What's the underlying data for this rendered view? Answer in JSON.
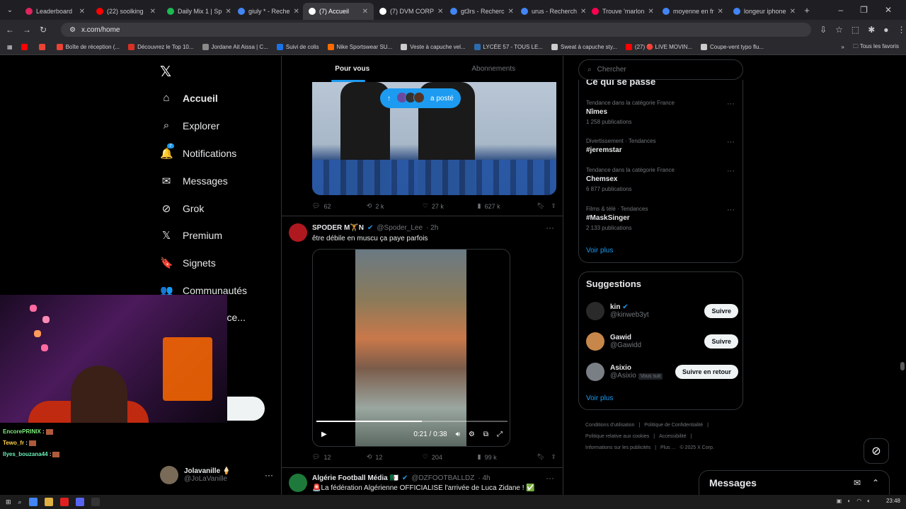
{
  "browser": {
    "tabs": [
      {
        "label": "Leaderboard",
        "color": "#e0245e",
        "active": false
      },
      {
        "label": "(22) soolking",
        "color": "#ff0000",
        "active": false
      },
      {
        "label": "Daily Mix 1 | Sp",
        "color": "#1db954",
        "active": false
      },
      {
        "label": "giuly * - Reche",
        "color": "#4285f4",
        "active": false
      },
      {
        "label": "(7) Accueil",
        "color": "#ffffff",
        "active": true
      },
      {
        "label": "(7) DVM CORP",
        "color": "#ffffff",
        "active": false
      },
      {
        "label": "gt3rs - Recherc",
        "color": "#4285f4",
        "active": false
      },
      {
        "label": "urus - Recherch",
        "color": "#4285f4",
        "active": false
      },
      {
        "label": "Trouve 'marlon",
        "color": "#ff0050",
        "active": false
      },
      {
        "label": "moyenne en fr",
        "color": "#4285f4",
        "active": false
      },
      {
        "label": "longeur iphone",
        "color": "#4285f4",
        "active": false
      }
    ],
    "new_tab": "+",
    "url": "x.com/home",
    "bookmarks": [
      {
        "label": "",
        "color": "#ff0000"
      },
      {
        "label": "",
        "color": "#ea4335"
      },
      {
        "label": "Boîte de réception (...",
        "color": "#ea4335"
      },
      {
        "label": "Découvrez le Top 10...",
        "color": "#d93025"
      },
      {
        "label": "Jordane Ait Aissa | C...",
        "color": "#8a8a8a"
      },
      {
        "label": "Suivi de colis",
        "color": "#1a73e8"
      },
      {
        "label": "Nike Sportswear SU...",
        "color": "#ff6a00"
      },
      {
        "label": "Veste à capuche vel...",
        "color": "#cccccc"
      },
      {
        "label": "LYCÉE 57 - TOUS LE...",
        "color": "#2b6cb0"
      },
      {
        "label": "Sweat à capuche sty...",
        "color": "#cccccc"
      },
      {
        "label": "(27) 🔴 LIVE MOVIN...",
        "color": "#ff0000"
      },
      {
        "label": "Coupe-vent typo flu...",
        "color": "#cccccc"
      }
    ],
    "all_bookmarks": "Tous les favoris"
  },
  "nav": {
    "items": [
      {
        "label": "Accueil",
        "icon": "home-icon",
        "glyph": "⌂",
        "bold": true
      },
      {
        "label": "Explorer",
        "icon": "search-icon",
        "glyph": "⌕",
        "bold": false
      },
      {
        "label": "Notifications",
        "icon": "bell-icon",
        "glyph": "🔔",
        "bold": false,
        "badge": "7"
      },
      {
        "label": "Messages",
        "icon": "mail-icon",
        "glyph": "✉",
        "bold": false
      },
      {
        "label": "Grok",
        "icon": "grok-icon",
        "glyph": "⊘",
        "bold": false
      },
      {
        "label": "Premium",
        "icon": "x-premium-icon",
        "glyph": "𝕏",
        "bold": false
      },
      {
        "label": "Signets",
        "icon": "bookmark-icon",
        "glyph": "🔖",
        "bold": false
      },
      {
        "label": "Communautés",
        "icon": "communities-icon",
        "glyph": "👥",
        "bold": false
      },
      {
        "label": "ons ce...",
        "icon": "",
        "glyph": "",
        "bold": false
      }
    ],
    "profile": {
      "name": "Jolavanille 🍦",
      "handle": "@JoLaVanille"
    }
  },
  "stream_chat": [
    {
      "user": "EncorePRINIX",
      "sep": " :"
    },
    {
      "user": "Tewo_fr",
      "sep": " :"
    },
    {
      "user": "Ilyes_bouzana44",
      "sep": " :"
    }
  ],
  "feed": {
    "tabs": [
      "Pour vous",
      "Abonnements"
    ],
    "posted_pill": "a posté",
    "post1_stats": {
      "replies": "62",
      "reposts": "2 k",
      "likes": "27 k",
      "views": "627 k"
    },
    "post2": {
      "name": "SPODER M🏋️N",
      "handle": "@Spoder_Lee",
      "time": "· 2h",
      "text": "être débile en muscu ça paye parfois",
      "video_time": "0:21 / 0:38",
      "video_progress": 0.55,
      "stats": {
        "replies": "12",
        "reposts": "12",
        "likes": "204",
        "views": "99 k"
      }
    },
    "post3": {
      "name": "Algérie Football Média 🇩🇿",
      "handle": "@DZFOOTBALLDZ",
      "time": "· 4h",
      "text": "🚨La fédération Algérienne OFFICIALISE l'arrivée de Luca Zidane ! ✅"
    }
  },
  "right": {
    "search_placeholder": "Chercher",
    "trends_title": "Ce qui se passe",
    "trends": [
      {
        "category": "Tendance dans la catégorie France",
        "name": "Nîmes",
        "count": "1 258 publications"
      },
      {
        "category": "Divertissement · Tendances",
        "name": "#jeremstar",
        "count": ""
      },
      {
        "category": "Tendance dans la catégorie France",
        "name": "Chemsex",
        "count": "6 877 publications"
      },
      {
        "category": "Films & télé · Tendances",
        "name": "#MaskSinger",
        "count": "2 133 publications"
      }
    ],
    "see_more": "Voir plus",
    "suggestions_title": "Suggestions",
    "suggestions": [
      {
        "name": "kin",
        "handle": "@kinweb3yt",
        "button": "Suivre",
        "follows_you": "",
        "color": "#2a2a2a"
      },
      {
        "name": "Gawid",
        "handle": "@Gawidd",
        "button": "Suivre",
        "follows_you": "",
        "color": "#c8874a"
      },
      {
        "name": "Asixio",
        "handle": "@Asixio",
        "button": "Suivre en retour",
        "follows_you": "Vous suit",
        "color": "#7a7f86"
      }
    ],
    "footer": [
      "Conditions d'utilisation",
      "|",
      "Politique de Confidentialité",
      "|",
      "Politique relative aux cookies",
      "|",
      "Accessibilité",
      "|",
      "Informations sur les publicités",
      "|",
      "Plus ...",
      "© 2025 X Corp."
    ]
  },
  "messages_dock": "Messages",
  "taskbar": {
    "time": "23:48"
  }
}
